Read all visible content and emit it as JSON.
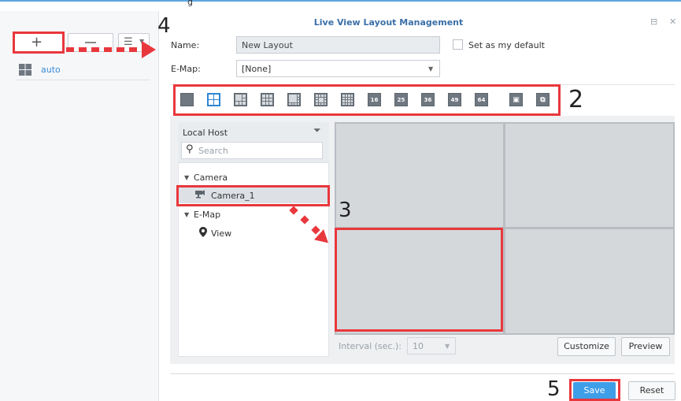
{
  "top_fragment": "g",
  "dialog": {
    "title": "Live View Layout Management",
    "minimize_glyph": "⊟",
    "close_glyph": "✕"
  },
  "left_panel": {
    "layouts": [
      {
        "label": "auto",
        "icon": "quad-grid-icon"
      }
    ],
    "toolbar_icons": [
      "plus-icon",
      "minus-icon",
      "sort-icon"
    ]
  },
  "form": {
    "name_label": "Name:",
    "name_value": "New Layout",
    "default_label": "Set as my default",
    "emap_label": "E-Map:",
    "emap_value": "[None]"
  },
  "layout_icons": [
    {
      "name": "layout-1x1-icon",
      "text": ""
    },
    {
      "name": "layout-2x2-icon",
      "text": ""
    },
    {
      "name": "layout-1plus5-icon",
      "text": ""
    },
    {
      "name": "layout-3x3-icon",
      "text": ""
    },
    {
      "name": "layout-1plus7-icon",
      "text": ""
    },
    {
      "name": "layout-1plus12-icon",
      "text": ""
    },
    {
      "name": "layout-4x4-dense-icon",
      "text": ""
    },
    {
      "name": "layout-16-icon",
      "text": "16"
    },
    {
      "name": "layout-25-icon",
      "text": "25"
    },
    {
      "name": "layout-36-icon",
      "text": "36"
    },
    {
      "name": "layout-49-icon",
      "text": "49"
    },
    {
      "name": "layout-64-icon",
      "text": "64"
    },
    {
      "name": "layout-custom-icon",
      "text": ""
    },
    {
      "name": "layout-fisheye-icon",
      "text": ""
    }
  ],
  "tree": {
    "header": "Local Host",
    "search_placeholder": "Search",
    "camera_group": "Camera",
    "camera_item": "Camera_1",
    "emap_group": "E-Map",
    "emap_item": "View"
  },
  "preview": {
    "interval_label": "Interval (sec.):",
    "interval_value": "10",
    "customize_label": "Customize",
    "preview_label": "Preview"
  },
  "footer": {
    "save_label": "Save",
    "reset_label": "Reset"
  },
  "annotations": {
    "step_add": "4",
    "step_layout_bar": "2",
    "step_drag": "3",
    "step_save": "5"
  },
  "colors": {
    "accent": "#3f9ee8",
    "annotation_red": "#e8383d",
    "title_blue": "#3a6fa8"
  }
}
